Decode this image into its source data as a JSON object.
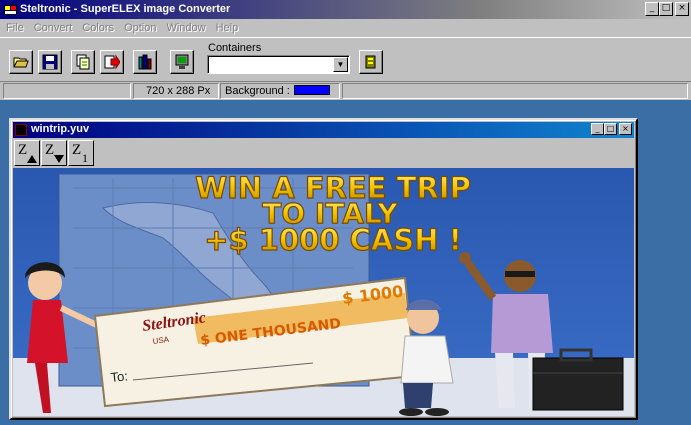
{
  "window": {
    "title": "Steltronic - SuperELEX image Converter",
    "controls": [
      "_",
      "□",
      "×"
    ]
  },
  "menu": [
    "File",
    "Convert",
    "Colors",
    "Option",
    "Window",
    "Help"
  ],
  "toolbar": {
    "buttons": [
      "open-icon",
      "save-icon",
      "convert-icon",
      "export-icon",
      "transfer-icon",
      "monitor-icon",
      "container-icon"
    ],
    "containers_label": "Containers",
    "containers_value": ""
  },
  "status": {
    "resolution": "720 x 288 Px",
    "background_label": "Background :",
    "background_color": "#0000ff"
  },
  "child": {
    "title": "wintrip.yuv",
    "controls": [
      "_",
      "□",
      "×"
    ],
    "zoom": {
      "zoom_in": "Z",
      "zoom_out": "Z",
      "zoom_1": "Z",
      "zoom_1_sub": "1"
    }
  },
  "image": {
    "headline_1": "WIN A FREE TRIP",
    "headline_2": "TO ITALY",
    "headline_3": "+$ 1000 CASH !",
    "check_brand": "Steltronic",
    "check_brand_sub": "USA",
    "check_amount": "$ 1000",
    "check_words": "$ ONE THOUSAND",
    "check_to": "To:"
  }
}
